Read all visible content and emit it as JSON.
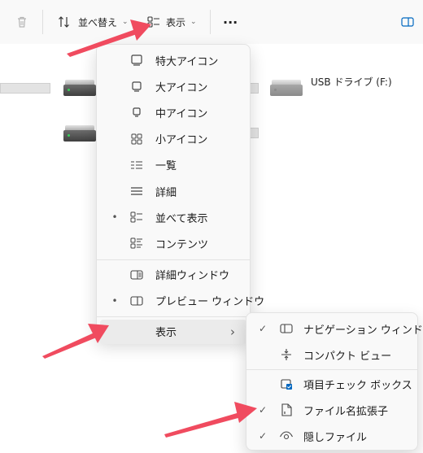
{
  "toolbar": {
    "sort_label": "並べ替え",
    "view_label": "表示",
    "more_label": "···"
  },
  "drives": {
    "usb_label": "USB ドライブ (F:)"
  },
  "view_menu": {
    "items": [
      {
        "label": "特大アイコン",
        "icon": "extra-large-icons-icon",
        "selected": false
      },
      {
        "label": "大アイコン",
        "icon": "large-icons-icon",
        "selected": false
      },
      {
        "label": "中アイコン",
        "icon": "medium-icons-icon",
        "selected": false
      },
      {
        "label": "小アイコン",
        "icon": "small-icons-icon",
        "selected": false
      },
      {
        "label": "一覧",
        "icon": "list-icon",
        "selected": false
      },
      {
        "label": "詳細",
        "icon": "details-icon",
        "selected": false
      },
      {
        "label": "並べて表示",
        "icon": "tiles-icon",
        "selected": true
      },
      {
        "label": "コンテンツ",
        "icon": "content-icon",
        "selected": false
      }
    ],
    "panes": [
      {
        "label": "詳細ウィンドウ",
        "icon": "details-pane-icon",
        "selected": false
      },
      {
        "label": "プレビュー ウィンドウ",
        "icon": "preview-pane-icon",
        "selected": true
      }
    ],
    "show_label": "表示",
    "bullet": "•",
    "submenu_chevron": "›"
  },
  "show_submenu": {
    "items": [
      {
        "label": "ナビゲーション ウィンドウ",
        "icon": "navigation-pane-icon",
        "checked": true
      },
      {
        "label": "コンパクト ビュー",
        "icon": "compact-view-icon",
        "checked": false
      },
      {
        "label": "項目チェック ボックス",
        "icon": "item-checkbox-icon",
        "checked": false
      },
      {
        "label": "ファイル名拡張子",
        "icon": "file-extension-icon",
        "checked": true
      },
      {
        "label": "隠しファイル",
        "icon": "hidden-files-icon",
        "checked": true
      }
    ],
    "check_glyph": "✓"
  },
  "colors": {
    "annotation_arrow": "#f04b5f",
    "accent": "#0067c0"
  }
}
